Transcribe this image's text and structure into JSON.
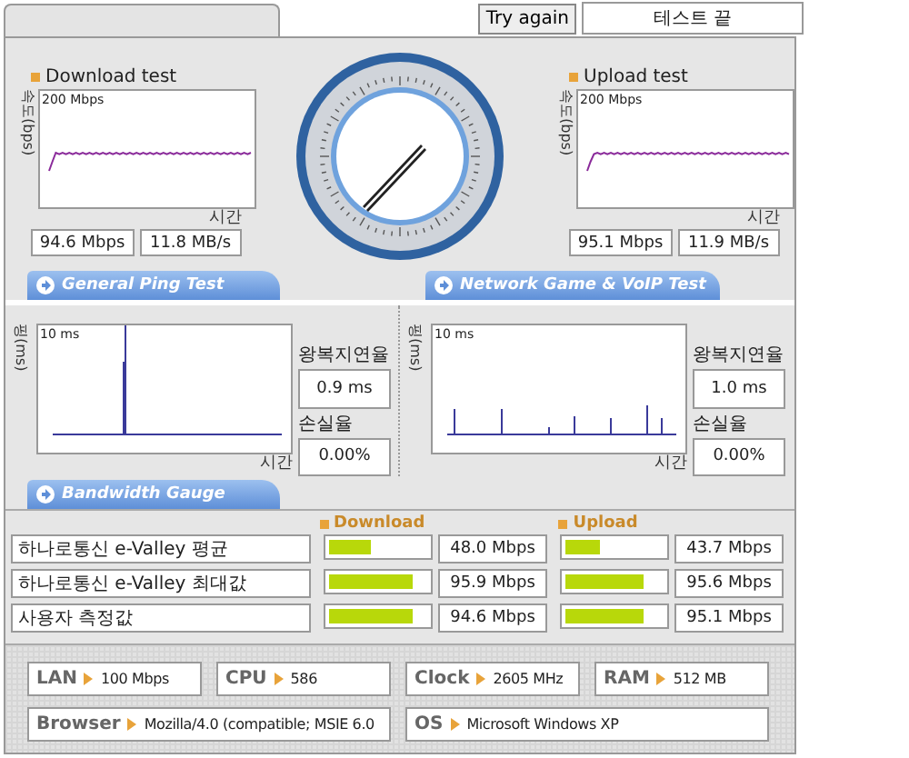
{
  "top_bar": {
    "try_again_button": "Try again",
    "status": "테스트 끝"
  },
  "speed_tests": [
    {
      "title": "Download test",
      "y_axis": "속도(bps)",
      "scale": "200 Mbps",
      "x_axis": "시간",
      "rate": "94.6 Mbps",
      "bytes": "11.8 MB/s"
    },
    {
      "title": "Upload test",
      "y_axis": "속도(bps)",
      "scale": "200 Mbps",
      "x_axis": "시간",
      "rate": "95.1 Mbps",
      "bytes": "11.9 MB/s"
    }
  ],
  "ping_tests": [
    {
      "tab": "General Ping Test",
      "y_axis": "핑(ms)",
      "scale": "10 ms",
      "x_axis": "시간",
      "latency_label": "왕복지연율",
      "latency": "0.9 ms",
      "loss_label": "손실율",
      "loss": "0.00%"
    },
    {
      "tab": "Network Game & VoIP Test",
      "y_axis": "핑(ms)",
      "scale": "10 ms",
      "x_axis": "시간",
      "latency_label": "왕복지연율",
      "latency": "1.0 ms",
      "loss_label": "손실율",
      "loss": "0.00%"
    }
  ],
  "bandwidth": {
    "tab": "Bandwidth Gauge",
    "columns": [
      "Download",
      "Upload"
    ],
    "rows": [
      {
        "label": "하나로통신 e-Valley 평균",
        "download": {
          "level": 0.43,
          "value": "48.0 Mbps"
        },
        "upload": {
          "level": 0.36,
          "value": "43.7 Mbps"
        }
      },
      {
        "label": "하나로통신 e-Valley 최대값",
        "download": {
          "level": 0.85,
          "value": "95.9 Mbps"
        },
        "upload": {
          "level": 0.79,
          "value": "95.6 Mbps"
        }
      },
      {
        "label": "사용자 측정값",
        "download": {
          "level": 0.85,
          "value": "94.6 Mbps"
        },
        "upload": {
          "level": 0.79,
          "value": "95.1 Mbps"
        }
      }
    ]
  },
  "system": [
    {
      "label": "LAN",
      "value": "100 Mbps"
    },
    {
      "label": "CPU",
      "value": "586"
    },
    {
      "label": "Clock",
      "value": "2605 MHz"
    },
    {
      "label": "RAM",
      "value": "512 MB"
    },
    {
      "label": "Browser",
      "value": "Mozilla/4.0 (compatible; MSIE 6.0"
    },
    {
      "label": "OS",
      "value": "Microsoft Windows XP"
    }
  ]
}
